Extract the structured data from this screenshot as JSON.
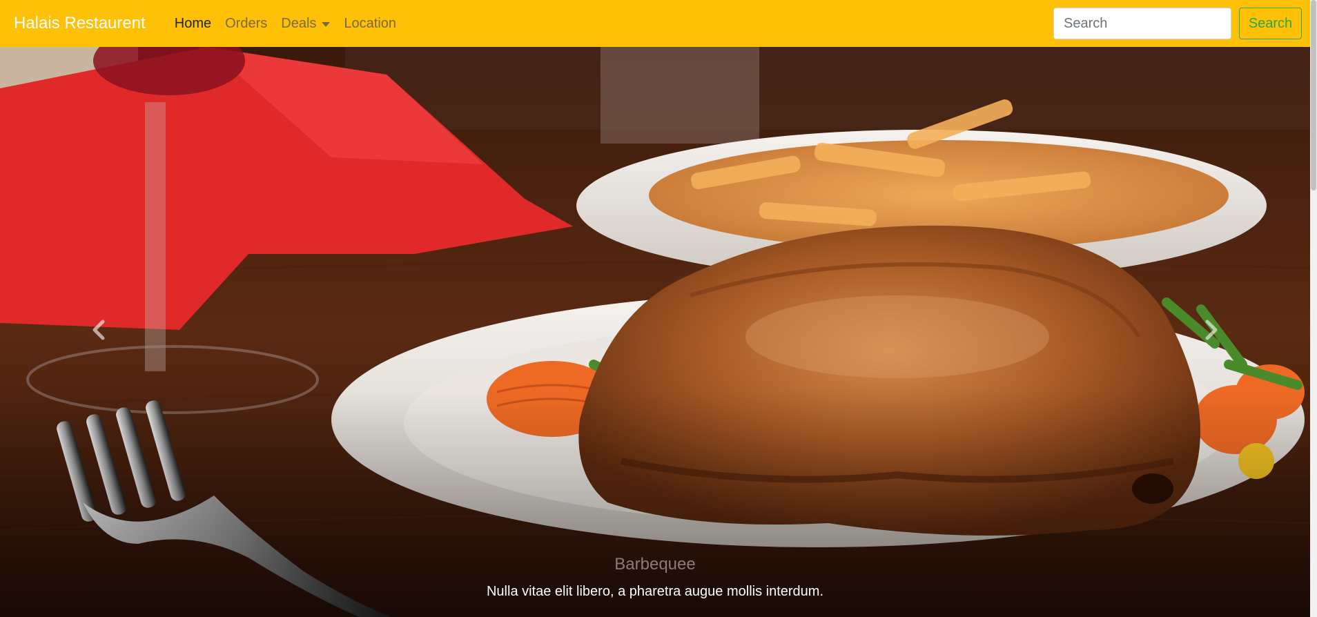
{
  "navbar": {
    "brand": "Halais Restaurent",
    "links": [
      {
        "label": "Home",
        "active": true
      },
      {
        "label": "Orders",
        "active": false
      },
      {
        "label": "Deals",
        "active": false,
        "dropdown": true
      },
      {
        "label": "Location",
        "active": false
      }
    ],
    "search_placeholder": "Search",
    "search_button": "Search"
  },
  "carousel": {
    "slide": {
      "title": "Barbequee",
      "text": "Nulla vitae elit libero, a pharetra augue mollis interdum."
    },
    "prev_icon": "chevron-left-icon",
    "next_icon": "chevron-right-icon"
  },
  "colors": {
    "navbar_bg": "#ffc107",
    "search_button": "#28a745",
    "brand_text": "#ffffff"
  }
}
